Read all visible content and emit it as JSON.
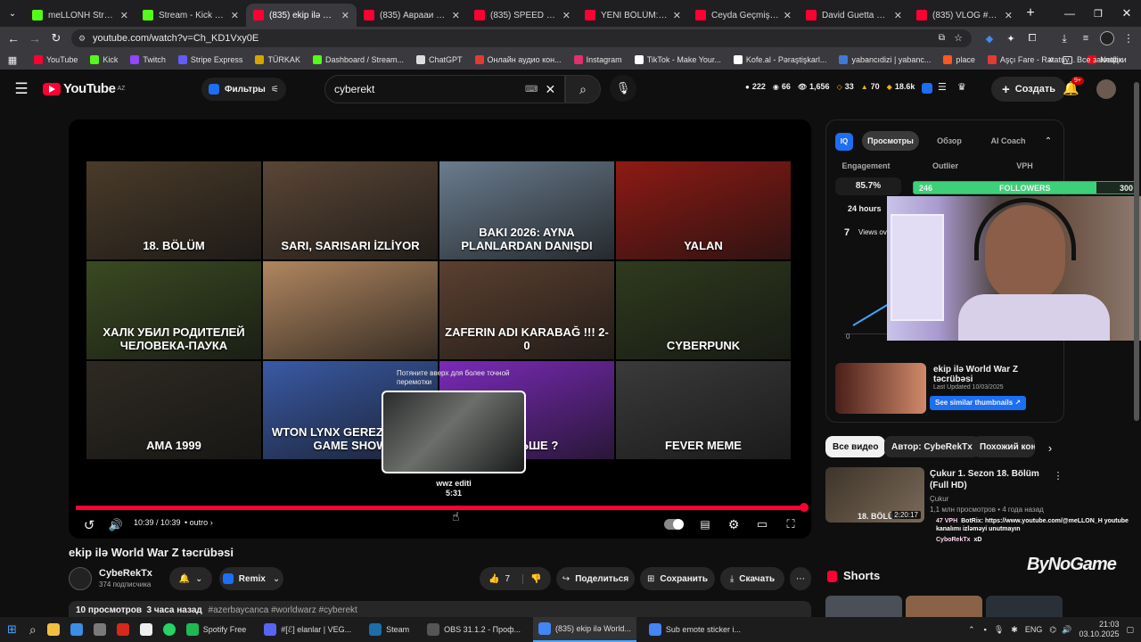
{
  "browser": {
    "tabs": [
      {
        "title": "meLLONH Stream - V",
        "color": "#53fc18"
      },
      {
        "title": "Stream - Kick Dashbo",
        "color": "#53fc18"
      },
      {
        "title": "(835) ekip ilə World W",
        "color": "#ff0033"
      },
      {
        "title": "(835) Аврааи Руссо",
        "color": "#ff0033"
      },
      {
        "title": "(835) SPEED GOES PI",
        "color": "#ff0033"
      },
      {
        "title": "YENİ BÖLÜM: @lynxs",
        "color": "#ff0033"
      },
      {
        "title": "Ceyda Geçmişim İle Y",
        "color": "#ff0033"
      },
      {
        "title": "David Guetta & Show",
        "color": "#ff0033"
      },
      {
        "title": "(835) VLOG #1 Баку,",
        "color": "#ff0033"
      }
    ],
    "url": "youtube.com/watch?v=Ch_KD1Vxy0E",
    "bookmarks": [
      {
        "label": "YouTube",
        "color": "#ff0033"
      },
      {
        "label": "Kick",
        "color": "#53fc18"
      },
      {
        "label": "Twitch",
        "color": "#9146ff"
      },
      {
        "label": "Stripe Express",
        "color": "#635bff"
      },
      {
        "label": "TÜRKAK",
        "color": "#d9a400"
      },
      {
        "label": "Dashboard / Stream...",
        "color": "#53fc18"
      },
      {
        "label": "ChatGPT",
        "color": "#dddddd"
      },
      {
        "label": "Онлайн аудио кон...",
        "color": "#e53935"
      },
      {
        "label": "Instagram",
        "color": "#e1306c"
      },
      {
        "label": "TikTok - Make Your...",
        "color": "#ffffff"
      },
      {
        "label": "Kofe.al - Pəraştişkarl...",
        "color": "#ffffff"
      },
      {
        "label": "yabancıdizi | yabanc...",
        "color": "#3d7bd6"
      },
      {
        "label": "place",
        "color": "#ff5722"
      },
      {
        "label": "Aşçı Fare - Ratatuy...",
        "color": "#e53935"
      },
      {
        "label": "Netflix",
        "color": "#e50914"
      }
    ],
    "all_bookmarks": "Все закладки"
  },
  "youtube": {
    "logo_text": "YouTube",
    "logo_region": "AZ",
    "filters_label": "Фильтры",
    "search_value": "cyberekt",
    "stats": [
      "222",
      "66",
      "1,656",
      "33",
      "70",
      "18.6k"
    ],
    "create_label": "Создать",
    "notif_count": "9+",
    "video": {
      "title": "ekip ilə World War Z təcrübəsi",
      "time": "10:39 / 10:39",
      "chapter": "outro",
      "hover_chapter": "wwz editi",
      "hover_time": "5:31",
      "drag_hint": "Потяните вверх для более точной перемотки",
      "progress": 1.0
    },
    "thumbs": [
      {
        "label": "18. BÖLÜM",
        "bg": "#4a3b2a"
      },
      {
        "label": "SARI, SARISARI İZLİYOR",
        "bg": "#5a4636"
      },
      {
        "label": "BAKI 2026: AYNA PLANLARDAN DANIŞDI",
        "bg": "#6a7c8e"
      },
      {
        "label": "YALAN",
        "bg": "#8e1a14"
      },
      {
        "label": "ХАЛК УБИЛ РОДИТЕЛЕЙ ЧЕЛОВЕКА-ПАУКА",
        "bg": "#3a4a22"
      },
      {
        "label": "",
        "bg": "#b08660"
      },
      {
        "label": "ZAFERIN ADI KARABAĞ !!! 2-0",
        "bg": "#5b4030"
      },
      {
        "label": "CYBERPUNK",
        "bg": "#2f3a1e"
      },
      {
        "label": "AMA 1999",
        "bg": "#2e2a22"
      },
      {
        "label": "WTON LYNX GEREZZ GOOD GAME SHOW",
        "bg": "#3a5aa5"
      },
      {
        "label": "ДАЛЬШЕ ?",
        "bg": "#7a2ab8"
      },
      {
        "label": "FEVER MEME",
        "bg": "#3b3a3a"
      }
    ],
    "channel": {
      "name": "CybeRekTx",
      "subs": "374 подписчика",
      "remix": "Remix"
    },
    "likes": "7",
    "share": "Поделиться",
    "save": "Сохранить",
    "download": "Скачать",
    "meta": "10 просмотров  3 часа назад",
    "tags": "#azerbaycanca #worldwarz #cyberekt",
    "vidiq": {
      "tabs": [
        "Просмотры",
        "Обзор",
        "AI Coach"
      ],
      "metrics": [
        "Engagement",
        "Outlier",
        "VPH"
      ],
      "engagement": "85.7%",
      "period": "24 hours",
      "views": "7",
      "views_label": "Views ov",
      "zero": "0",
      "followers_current": "246",
      "followers_label": "FOLLOWERS",
      "followers_goal": "300",
      "rec_title": "ekip ilə World War Z təcrübəsi",
      "rec_updated": "Last Updated 10/03/2025",
      "rec_button": "See similar thumbnails"
    },
    "chips": [
      "Все видео",
      "Автор: CybeRekTx",
      "Похожий кон"
    ],
    "related": {
      "title": "Çukur 1. Sezon 18. Bölüm (Full HD)",
      "channel": "Çukur",
      "meta": "1,1 млн просмотров • 4 года назад",
      "duration": "2:20:17",
      "thumb_label": "18. BÖLÜM"
    },
    "chat": [
      {
        "user": "47 VPH",
        "text": "BotRix: https://www.youtube.com/@meLLON_H youtube kanalımı izləməyi unutmayın"
      },
      {
        "user": "CyboRekTx",
        "text": "xD"
      }
    ],
    "bynogame": "ByNoGame",
    "shorts_label": "Shorts"
  },
  "taskbar": {
    "apps": [
      {
        "label": "Spotify Free",
        "color": "#1db954"
      },
      {
        "label": "#[ℰ] elanlar | VEG...",
        "color": "#5865f2"
      },
      {
        "label": "Steam",
        "color": "#1b6ea8"
      },
      {
        "label": "OBS 31.1.2 - Проф...",
        "color": "#555555"
      },
      {
        "label": "(835) ekip ilə World...",
        "color": "#4285f4"
      },
      {
        "label": "Sub emote sticker i...",
        "color": "#4285f4"
      }
    ],
    "lang": "ENG",
    "time": "21:03",
    "date": "03.10.2025"
  }
}
